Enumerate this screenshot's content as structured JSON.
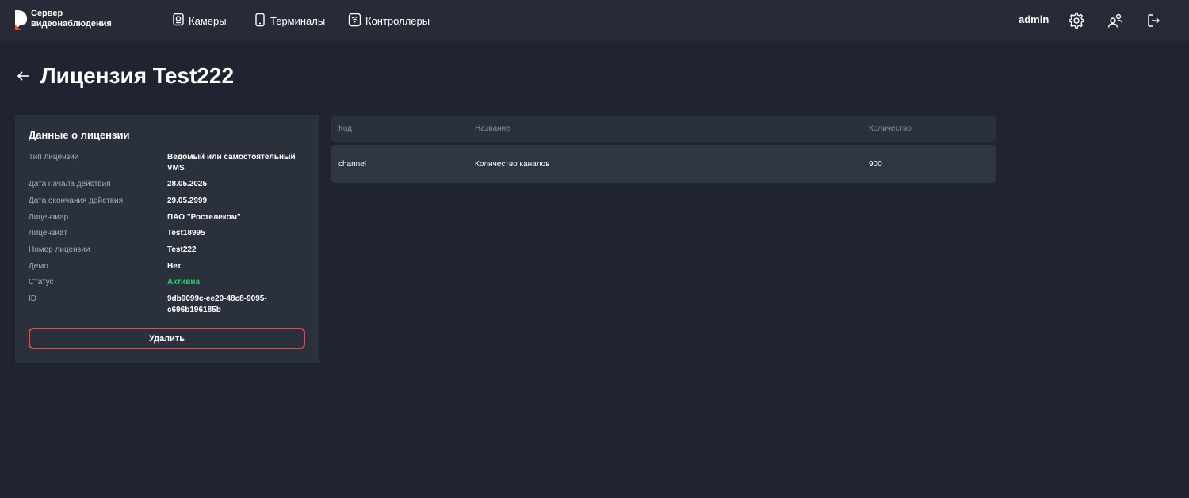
{
  "header": {
    "logo_line1": "Сервер",
    "logo_line2": "видеонаблюдения",
    "nav": [
      {
        "label": "Камеры",
        "icon": "camera-icon"
      },
      {
        "label": "Терминалы",
        "icon": "terminal-icon"
      },
      {
        "label": "Контроллеры",
        "icon": "controller-icon"
      }
    ],
    "user": "admin",
    "icons": [
      "gear-icon",
      "users-icon",
      "logout-icon"
    ],
    "accent_color": "#ff4f12"
  },
  "page": {
    "title": "Лицензия Test222"
  },
  "license": {
    "panel_title": "Данные о лицензии",
    "rows": [
      {
        "label": "Тип лицензии",
        "value": "Ведомый или самостоятельный VMS"
      },
      {
        "label": "Дата начала действия",
        "value": "28.05.2025"
      },
      {
        "label": "Дата окончания действия",
        "value": "29.05.2999"
      },
      {
        "label": "Лицензиар",
        "value": "ПАО \"Ростелеком\""
      },
      {
        "label": "Лицензиат",
        "value": "Test18995"
      },
      {
        "label": "Номер лицензии",
        "value": "Test222"
      },
      {
        "label": "Демо",
        "value": "Нет"
      },
      {
        "label": "Статус",
        "value": "Активна"
      },
      {
        "label": "ID",
        "value": "9db9099c-ee20-48c8-9095-c696b196185b"
      }
    ],
    "status_color": "#2ecc71",
    "delete_label": "Удалить"
  },
  "table": {
    "columns": [
      "Код",
      "Название",
      "Количество"
    ],
    "rows": [
      {
        "code": "channel",
        "name": "Количество каналов",
        "count": "900"
      }
    ]
  }
}
